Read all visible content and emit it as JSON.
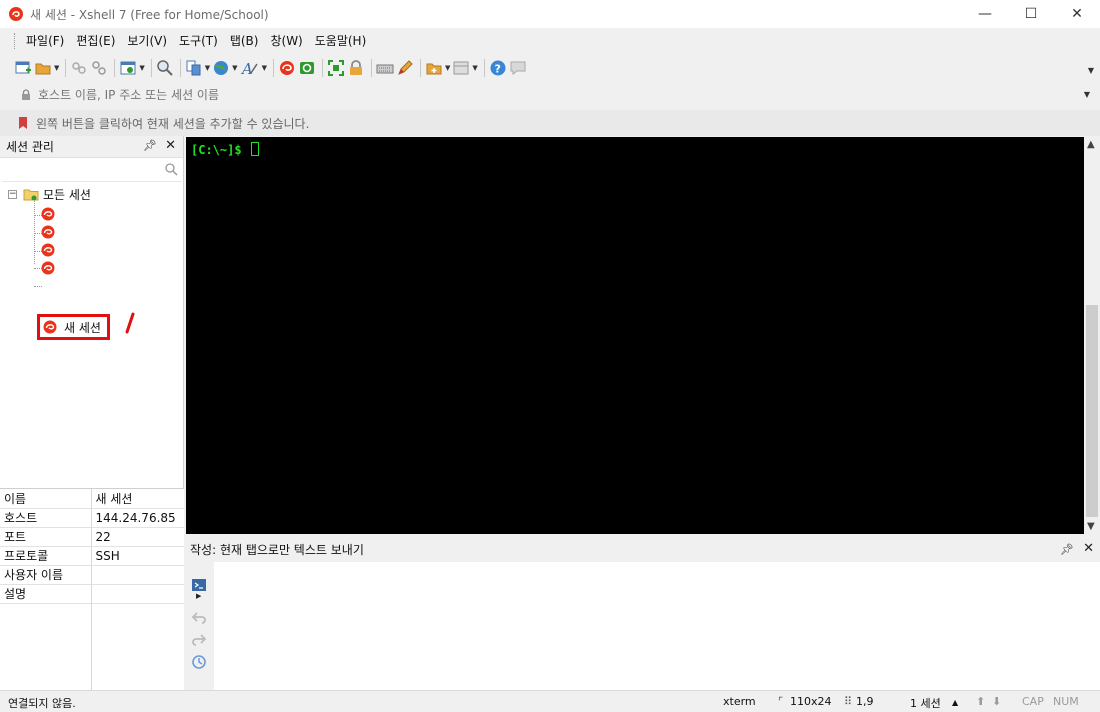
{
  "window": {
    "title": "새 세션 - Xshell 7 (Free for Home/School)",
    "minimize": "—",
    "maximize": "☐",
    "close": "✕"
  },
  "menu": [
    "파일(F)",
    "편집(E)",
    "보기(V)",
    "도구(T)",
    "탭(B)",
    "창(W)",
    "도움말(H)"
  ],
  "address": {
    "placeholder": "호스트 이름, IP 주소 또는 세션 이름"
  },
  "hint": "왼쪽 버튼을 클릭하여 현재 세션을 추가할 수 있습니다.",
  "session_manager": {
    "title": "세션 관리",
    "root_label": "모든 세션",
    "root_expander": "−",
    "selected_session": "새 세션"
  },
  "properties": {
    "rows": [
      {
        "key": "이름",
        "value": "새 세션"
      },
      {
        "key": "호스트",
        "value": "144.24.76.85"
      },
      {
        "key": "포트",
        "value": "22"
      },
      {
        "key": "프로토콜",
        "value": "SSH"
      },
      {
        "key": "사용자 이름",
        "value": ""
      },
      {
        "key": "설명",
        "value": ""
      }
    ]
  },
  "terminal": {
    "prompt": "[C:\\~]$ "
  },
  "compose": {
    "title": "작성: 현재 탭으로만 텍스트 보내기"
  },
  "status": {
    "connection": "연결되지 않음.",
    "term_type": "xterm",
    "size": "110x24",
    "cursor_pos": "1,9",
    "sessions": "1 세션",
    "cap": "CAP",
    "num": "NUM"
  },
  "colors": {
    "terminal_bg": "#000000",
    "prompt_fg": "#22e022",
    "highlight": "#e01010"
  }
}
